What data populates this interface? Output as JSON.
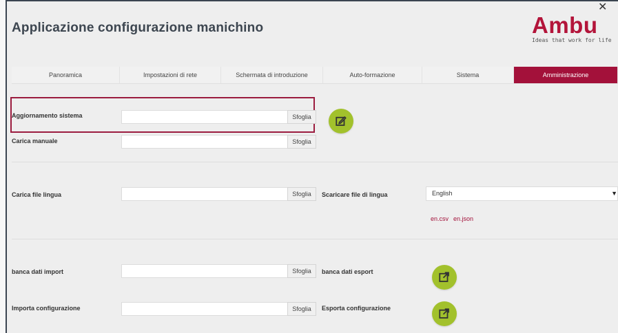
{
  "header": {
    "title": "Applicazione configurazione manichino",
    "logo_text": "Ambu",
    "logo_tagline": "Ideas that work for life",
    "close_glyph": "✕"
  },
  "tabs": [
    {
      "label": "Panoramica"
    },
    {
      "label": "Impostazioni di rete"
    },
    {
      "label": "Schermata di introduzione"
    },
    {
      "label": "Auto-formazione"
    },
    {
      "label": "Sistema"
    },
    {
      "label": "Amministrazione",
      "active": true
    }
  ],
  "form": {
    "browse_label": "Sfoglia",
    "system_update": {
      "label": "Aggiornamento sistema",
      "value": ""
    },
    "manual_upload": {
      "label": "Carica manuale",
      "value": ""
    },
    "language_upload": {
      "label": "Carica file lingua",
      "value": ""
    },
    "language_download": {
      "label": "Scaricare file di lingua",
      "selected": "English",
      "links": [
        "en.csv",
        "en.json"
      ]
    },
    "db_import": {
      "label": "banca dati import",
      "value": ""
    },
    "db_export": {
      "label": "banca dati esport"
    },
    "config_import": {
      "label": "Importa configurazione",
      "value": ""
    },
    "config_export": {
      "label": "Esporta configurazione"
    }
  },
  "colors": {
    "accent": "#a3113a",
    "action_button": "#a2c12c",
    "background": "#eeeeee"
  },
  "icons": {
    "action": "edit-icon",
    "export": "external-link-icon"
  }
}
